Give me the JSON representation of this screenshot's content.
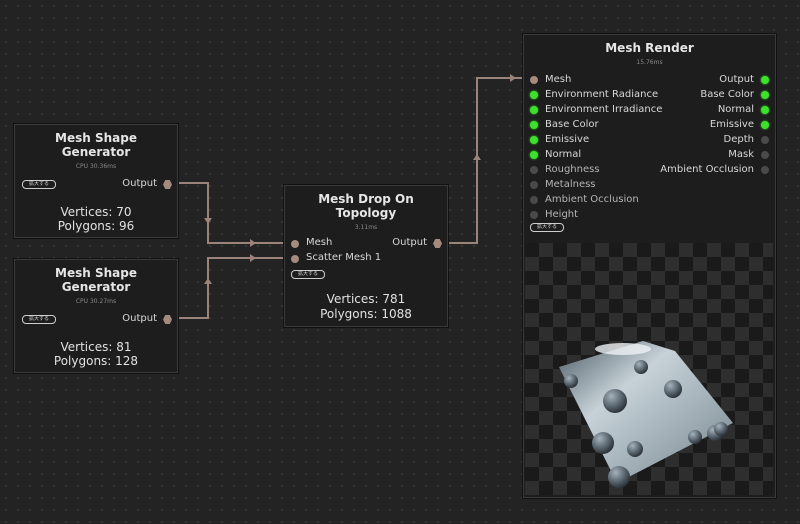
{
  "nodes": {
    "gen1": {
      "title": "Mesh Shape\nGenerator",
      "timing": "CPU 30.36ms",
      "expand_label": "拡大する",
      "output_label": "Output",
      "vertices": "Vertices: 70",
      "polygons": "Polygons: 96"
    },
    "gen2": {
      "title": "Mesh Shape\nGenerator",
      "timing": "CPU 30.27ms",
      "expand_label": "拡大する",
      "output_label": "Output",
      "vertices": "Vertices: 81",
      "polygons": "Polygons: 128"
    },
    "drop": {
      "title": "Mesh Drop On\nTopology",
      "timing": "3.11ms",
      "expand_label": "拡大する",
      "inputs": [
        "Mesh",
        "Scatter Mesh 1"
      ],
      "output_label": "Output",
      "vertices": "Vertices: 781",
      "polygons": "Polygons: 1088"
    },
    "render": {
      "title": "Mesh Render",
      "timing": "15.76ms",
      "expand_label": "拡大する",
      "inputs": [
        {
          "label": "Mesh",
          "state": "mesh"
        },
        {
          "label": "Environment Radiance",
          "state": "connected"
        },
        {
          "label": "Environment Irradiance",
          "state": "connected"
        },
        {
          "label": "Base Color",
          "state": "connected"
        },
        {
          "label": "Emissive",
          "state": "connected"
        },
        {
          "label": "Normal",
          "state": "connected"
        },
        {
          "label": "Roughness",
          "state": "empty"
        },
        {
          "label": "Metalness",
          "state": "empty"
        },
        {
          "label": "Ambient Occlusion",
          "state": "empty"
        },
        {
          "label": "Height",
          "state": "empty"
        }
      ],
      "outputs": [
        {
          "label": "Output",
          "state": "connected"
        },
        {
          "label": "Base Color",
          "state": "connected"
        },
        {
          "label": "Normal",
          "state": "connected"
        },
        {
          "label": "Emissive",
          "state": "connected"
        },
        {
          "label": "Depth",
          "state": "empty"
        },
        {
          "label": "Mask",
          "state": "empty"
        },
        {
          "label": "Ambient Occlusion",
          "state": "empty"
        }
      ]
    }
  },
  "colors": {
    "wire": "#9c8379",
    "port_connected": "#3de02a",
    "port_empty": "#4a4a4a",
    "port_mesh": "#a58a7e"
  }
}
